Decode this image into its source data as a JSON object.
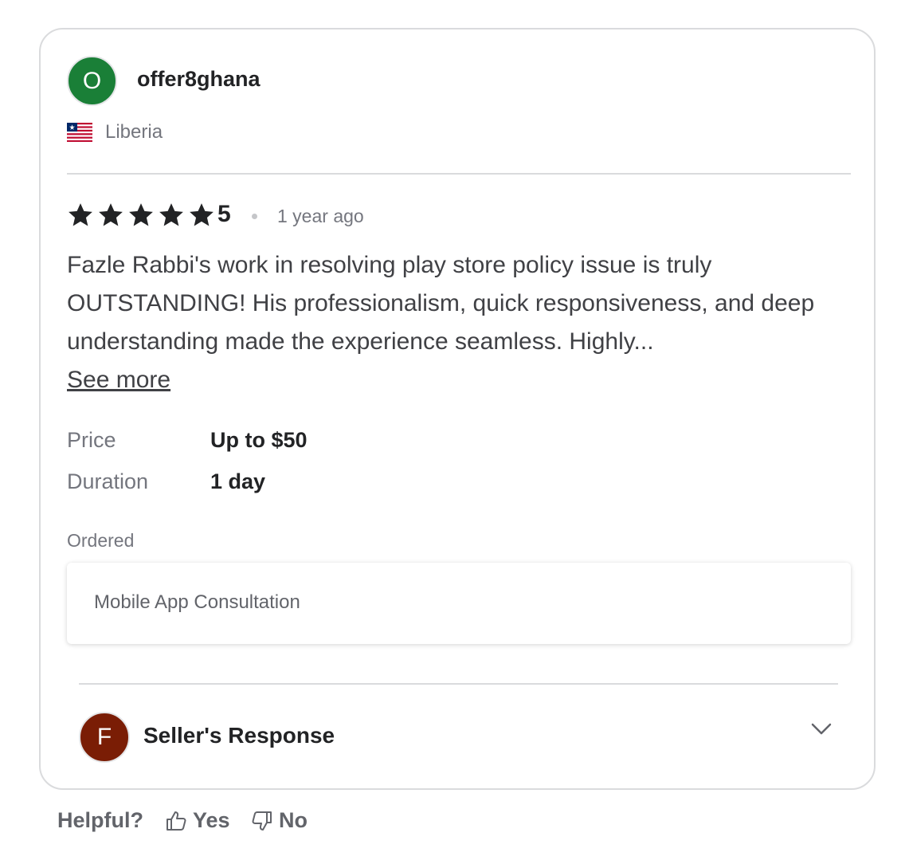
{
  "reviewer": {
    "avatar_initial": "O",
    "avatar_color": "#1a7f37",
    "username": "offer8ghana",
    "country": "Liberia",
    "flag_icon": "liberia-flag-icon"
  },
  "review": {
    "rating": 5,
    "rating_label": "5",
    "time_ago": "1 year ago",
    "text": "Fazle Rabbi's work in resolving play store policy issue is truly OUTSTANDING! His professionalism, quick responsiveness, and deep understanding made the experience seamless. Highly...",
    "see_more_label": "See more"
  },
  "details": {
    "price_label": "Price",
    "price_value": "Up to $50",
    "duration_label": "Duration",
    "duration_value": "1 day"
  },
  "ordered": {
    "label": "Ordered",
    "item": "Mobile App Consultation"
  },
  "seller_response": {
    "avatar_initial": "F",
    "avatar_color": "#7a1d05",
    "label": "Seller's Response",
    "toggle_icon": "chevron-down-icon"
  },
  "helpful": {
    "label": "Helpful?",
    "yes_label": "Yes",
    "no_label": "No",
    "yes_icon": "thumbs-up-icon",
    "no_icon": "thumbs-down-icon"
  }
}
